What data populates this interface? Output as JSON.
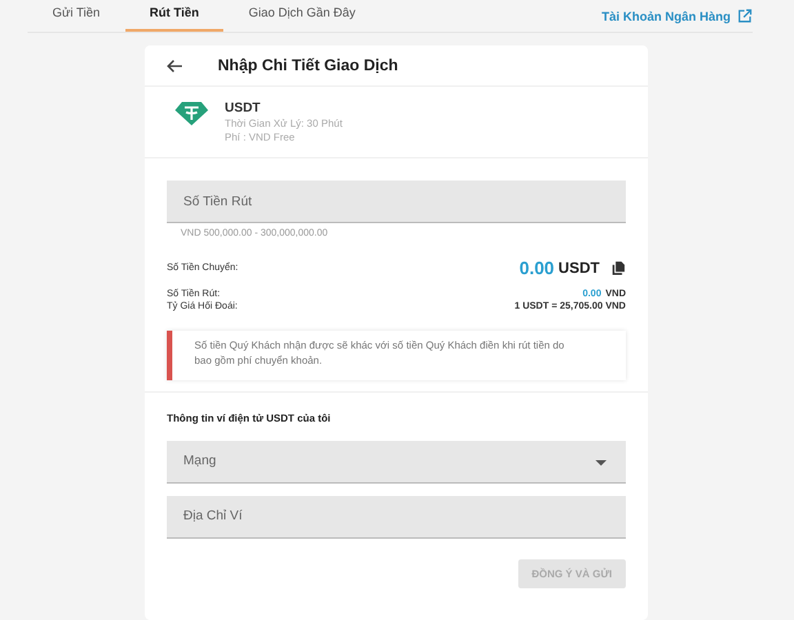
{
  "tabs": [
    {
      "label": "Gửi Tiền",
      "selected": false
    },
    {
      "label": "Rút Tiền",
      "selected": true
    },
    {
      "label": "Giao Dịch Gần Đây",
      "selected": false
    }
  ],
  "bank_link": "Tài Khoản Ngân Hàng",
  "card": {
    "title": "Nhập Chi Tiết Giao Dịch",
    "coin": {
      "name": "USDT",
      "processing_time": "Thời Gian Xử Lý: 30 Phút",
      "fee": "Phí : VND Free"
    },
    "amount_field": {
      "placeholder": "Số Tiền Rút",
      "hint": "VND 500,000.00 - 300,000,000.00"
    },
    "transfer": {
      "label": "Số Tiền Chuyển:",
      "amount": "0.00",
      "unit": "USDT"
    },
    "rows": [
      {
        "label": "Số Tiền Rút:",
        "amount": "0.00",
        "unit": "VND"
      },
      {
        "label": "Tỷ Giá Hối Đoái:",
        "amount": "1 USDT = 25,705.00 VND",
        "unit": ""
      }
    ],
    "warning": "Số tiền Quý Khách nhận được sẽ khác với số tiền Quý Khách điền khi rút tiền do bao gồm phí chuyển khoản.",
    "wallet_title": "Thông tin ví điện tử USDT của tôi",
    "wallet_fields": [
      {
        "kind": "select",
        "placeholder": "Mạng"
      },
      {
        "kind": "input",
        "placeholder": "Địa Chỉ Ví"
      }
    ],
    "submit": {
      "label": "ĐỒNG Ý VÀ GỬI",
      "disabled": true
    }
  }
}
